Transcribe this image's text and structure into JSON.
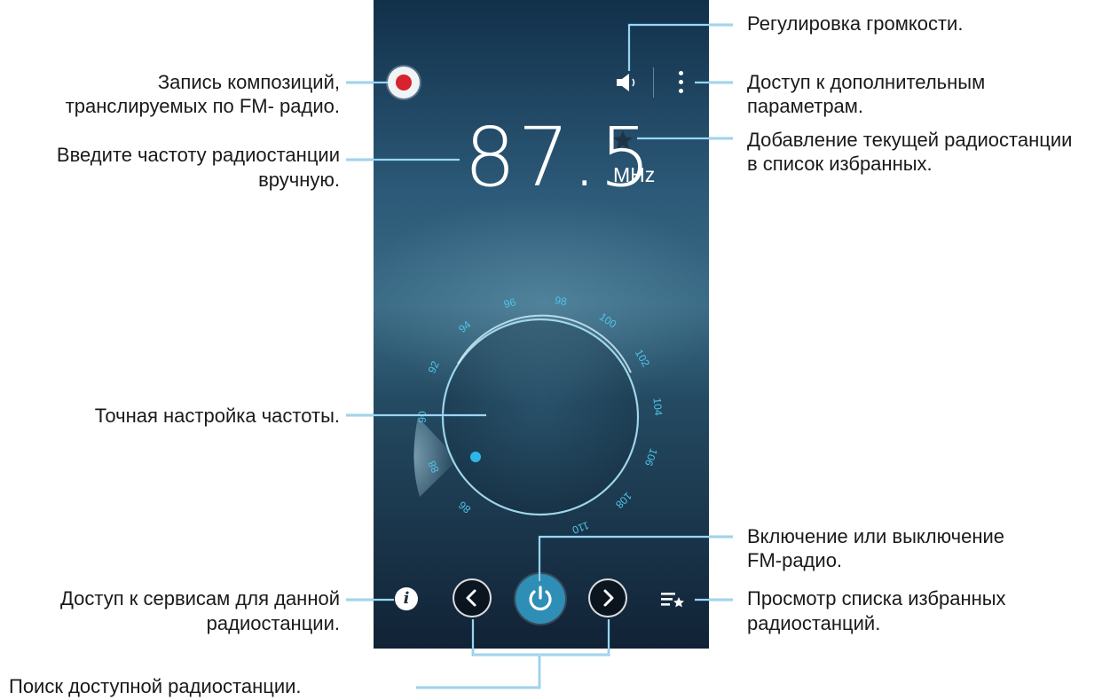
{
  "screen": {
    "frequency": "87.5",
    "unit": "MHz",
    "dial_ticks": [
      "86",
      "88",
      "90",
      "92",
      "94",
      "96",
      "98",
      "100",
      "102",
      "104",
      "106",
      "108",
      "110"
    ]
  },
  "icons": {
    "record": "record-icon",
    "volume": "volume-icon",
    "more": "more-options-icon",
    "favorite": "star-icon",
    "info": "info-icon",
    "prev": "chevron-left-icon",
    "power": "power-icon",
    "next": "chevron-right-icon",
    "favorites_list": "favorites-list-icon"
  },
  "colors": {
    "accent": "#2e8eb5",
    "dial_text": "#4fc3e8",
    "record": "#d7232e"
  },
  "annotations": {
    "volume": "Регулировка громкости.",
    "record_1": "Запись композиций,",
    "record_2": "транслируемых по FM- радио.",
    "more_1": "Доступ к дополнительным",
    "more_2": "параметрам.",
    "frequency_1": "Введите частоту радиостанции",
    "frequency_2": "вручную.",
    "favorite_1": "Добавление текущей радиостанции",
    "favorite_2": "в список избранных.",
    "fine_tune": "Точная настройка частоты.",
    "power_1": "Включение или выключение",
    "power_2": "FM-радио.",
    "info_1": "Доступ к сервисам для данной",
    "info_2": "радиостанции.",
    "favorites_list_1": "Просмотр списка избранных",
    "favorites_list_2": "радиостанций.",
    "search": "Поиск доступной радиостанции."
  }
}
